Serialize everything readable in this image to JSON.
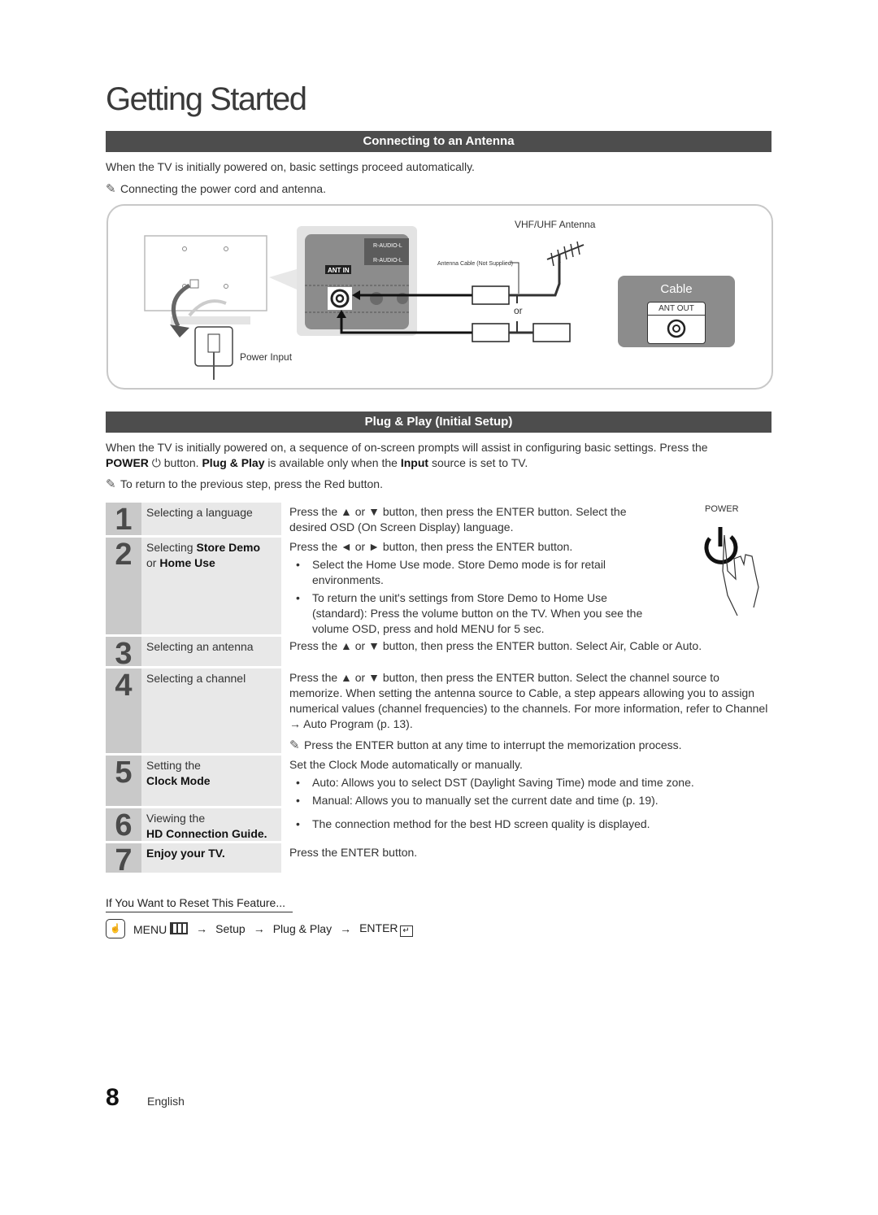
{
  "page": {
    "title": "Getting Started",
    "number": "8",
    "language": "English"
  },
  "antenna_section": {
    "heading": "Connecting to an Antenna",
    "intro": "When the TV is initially powered on, basic settings proceed automatically.",
    "note": "Connecting the power cord and antenna.",
    "diagram": {
      "vhf_label": "VHF/UHF Antenna",
      "cable_label": "Antenna Cable (Not Supplied)",
      "or_label": "or",
      "ant_in_label": "ANT IN",
      "audio_label_1": "R-AUDIO-L",
      "audio_label_2": "R-AUDIO-L",
      "power_input_label": "Power Input",
      "cable_box_title": "Cable",
      "ant_out_label": "ANT OUT"
    }
  },
  "plug_play_section": {
    "heading": "Plug & Play (Initial Setup)",
    "intro_1": "When the TV is initially powered on, a sequence of on-screen prompts will assist in configuring basic settings. Press the",
    "power_word": "POWER",
    "intro_2": "button.",
    "plug_play_word": "Plug & Play",
    "intro_3": "is available only when the",
    "input_word": "Input",
    "intro_4": "source is set to TV.",
    "note": "To return to the previous step, press the Red button.",
    "power_figure_label": "POWER",
    "steps": [
      {
        "num": "1",
        "label": "Selecting a language",
        "desc": "Press the ▲ or ▼ button, then press the ENTER button. Select the desired OSD (On Screen Display) language."
      },
      {
        "num": "2",
        "label_1": "Selecting",
        "label_b1": "Store Demo",
        "label_2": "or",
        "label_b2": "Home Use",
        "desc": "Press the ◄ or ► button, then press the ENTER button.",
        "bullets": [
          "Select the Home Use mode. Store Demo mode is for retail environments.",
          "To return the unit's settings from Store Demo to Home Use (standard): Press the volume button on the TV. When you see the volume OSD, press and hold MENU for 5 sec."
        ]
      },
      {
        "num": "3",
        "label": "Selecting an antenna",
        "desc": "Press the ▲ or ▼ button, then press the ENTER button. Select Air, Cable or Auto."
      },
      {
        "num": "4",
        "label": "Selecting a channel",
        "desc": "Press the ▲ or ▼ button, then press the ENTER button. Select the channel source to memorize. When setting the antenna source to Cable, a step appears allowing you to assign numerical values (channel frequencies) to the channels. For more information, refer to Channel → Auto Program (p. 13).",
        "note": "Press the ENTER button at any time to interrupt the memorization process."
      },
      {
        "num": "5",
        "label_1": "Setting the",
        "label_b1": "Clock Mode",
        "desc": "Set the Clock Mode automatically or manually.",
        "bullets": [
          "Auto: Allows you to select DST (Daylight Saving Time) mode and time zone.",
          "Manual: Allows you to manually set the current date and time (p. 19)."
        ]
      },
      {
        "num": "6",
        "label_1": "Viewing the",
        "label_b1": "HD Connection Guide.",
        "bullets": [
          "The connection method for the best HD screen quality is displayed."
        ]
      },
      {
        "num": "7",
        "label_b1": "Enjoy your TV.",
        "desc": "Press the ENTER button."
      }
    ]
  },
  "reset": {
    "title": "If You Want to Reset This Feature...",
    "path": [
      "MENU",
      "Setup",
      "Plug & Play",
      "ENTER"
    ],
    "arrow": "→"
  }
}
